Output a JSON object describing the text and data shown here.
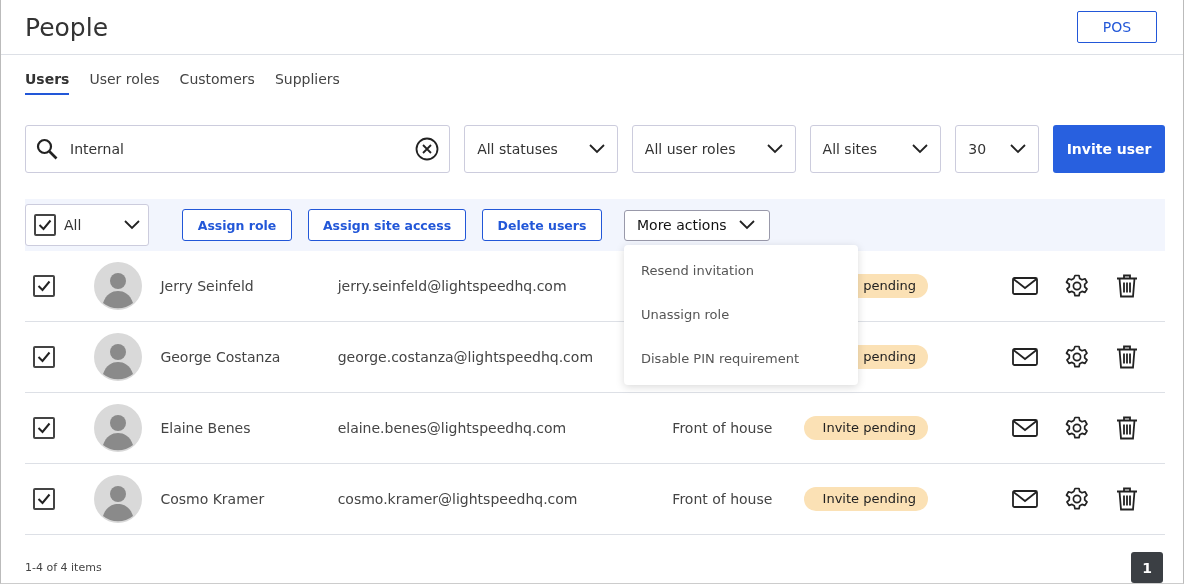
{
  "header": {
    "title": "People",
    "pos_button": "POS"
  },
  "tabs": [
    {
      "label": "Users",
      "selected": true
    },
    {
      "label": "User roles",
      "selected": false
    },
    {
      "label": "Customers",
      "selected": false
    },
    {
      "label": "Suppliers",
      "selected": false
    }
  ],
  "search": {
    "value": "Internal"
  },
  "filters": [
    {
      "label": "All statuses"
    },
    {
      "label": "All user roles"
    },
    {
      "label": "All sites"
    },
    {
      "label": "30"
    }
  ],
  "invite_button": "Invite user",
  "bulk": {
    "select_all": {
      "label": "All",
      "checked": true
    },
    "actions": [
      "Assign role",
      "Assign site access",
      "Delete users"
    ],
    "more": {
      "label": "More actions",
      "expanded": true,
      "items": [
        "Resend invitation",
        "Unassign role",
        "Disable PIN requirement"
      ]
    }
  },
  "users": [
    {
      "name": "Jerry Seinfeld",
      "email": "jerry.seinfeld@lightspeedhq.com",
      "status": "pending",
      "checked": true
    },
    {
      "name": "George Costanza",
      "email": "george.costanza@lightspeedhq.com",
      "status": "pending",
      "checked": true
    },
    {
      "name": "Elaine Benes",
      "email": "elaine.benes@lightspeedhq.com",
      "role": "Front of house",
      "status": "Invite pending",
      "checked": true
    },
    {
      "name": "Cosmo Kramer",
      "email": "cosmo.kramer@lightspeedhq.com",
      "role": "Front of house",
      "status": "Invite pending",
      "checked": true
    }
  ],
  "footer": {
    "count": "1-4 of 4 items",
    "page": "1"
  }
}
